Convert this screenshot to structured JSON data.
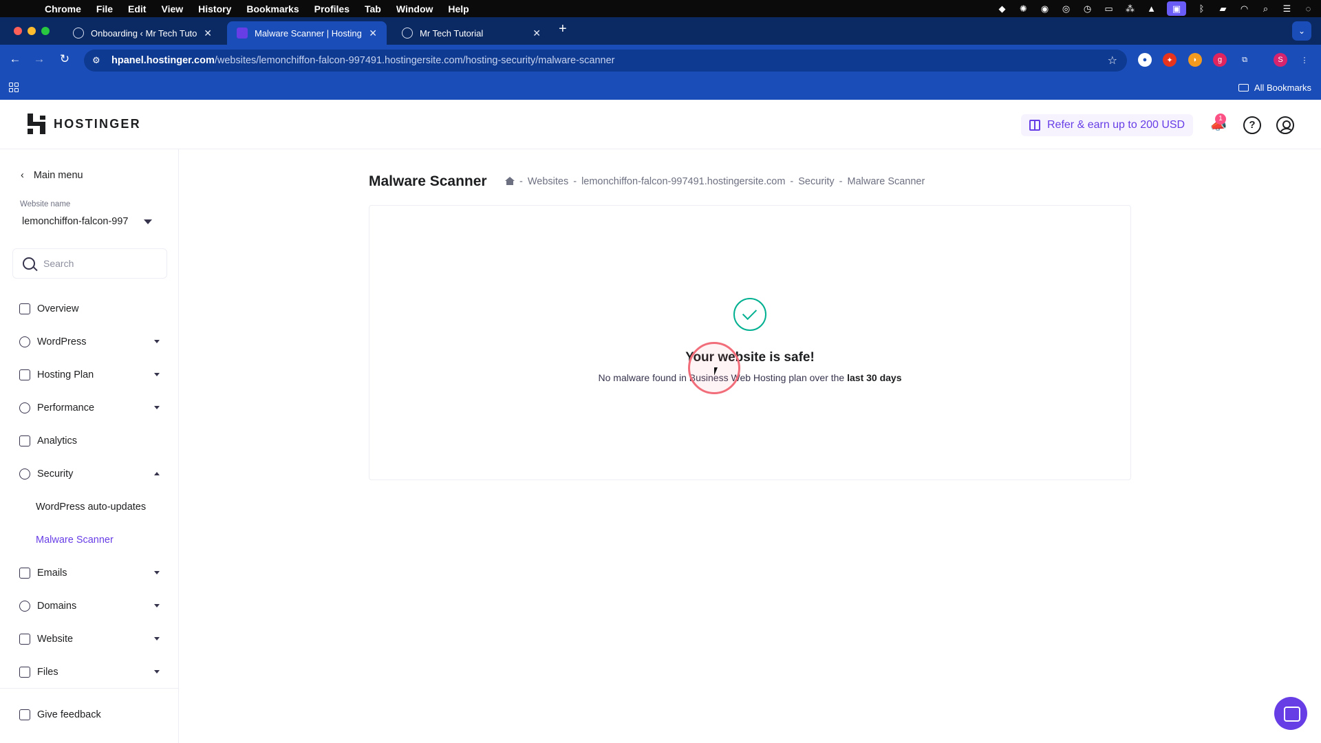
{
  "mac_menubar": {
    "items": [
      "Chrome",
      "File",
      "Edit",
      "View",
      "History",
      "Bookmarks",
      "Profiles",
      "Tab",
      "Window",
      "Help"
    ]
  },
  "tabs": [
    {
      "title": "Onboarding ‹ Mr Tech Tutoria",
      "active": false
    },
    {
      "title": "Malware Scanner | Hostinger",
      "active": true
    },
    {
      "title": "Mr Tech Tutorial",
      "active": false
    }
  ],
  "address_bar": {
    "host": "hpanel.hostinger.com",
    "path": "/websites/lemonchiffon-falcon-997491.hostingersite.com/hosting-security/malware-scanner"
  },
  "bookmarks_bar": {
    "all_bookmarks": "All Bookmarks"
  },
  "header": {
    "logo_text": "HOSTINGER",
    "refer_label": "Refer & earn up to 200 USD",
    "notification_count": "1"
  },
  "sidebar": {
    "main_menu": "Main menu",
    "website_label": "Website name",
    "website_value": "lemonchiffon-falcon-997",
    "search_placeholder": "Search",
    "items": [
      {
        "label": "Overview",
        "icon": "grid-icon",
        "expandable": false
      },
      {
        "label": "WordPress",
        "icon": "wordpress-icon",
        "expandable": true
      },
      {
        "label": "Hosting Plan",
        "icon": "server-icon",
        "expandable": true
      },
      {
        "label": "Performance",
        "icon": "gauge-icon",
        "expandable": true
      },
      {
        "label": "Analytics",
        "icon": "chart-icon",
        "expandable": false
      },
      {
        "label": "Security",
        "icon": "shield-icon",
        "expandable": true,
        "expanded": true
      },
      {
        "label": "Emails",
        "icon": "mail-icon",
        "expandable": true
      },
      {
        "label": "Domains",
        "icon": "globe-icon",
        "expandable": true
      },
      {
        "label": "Website",
        "icon": "browser-icon",
        "expandable": true
      },
      {
        "label": "Files",
        "icon": "folder-icon",
        "expandable": true
      }
    ],
    "security_subitems": [
      "WordPress auto-updates",
      "Malware Scanner"
    ],
    "active_subitem": "Malware Scanner",
    "feedback": "Give feedback"
  },
  "main": {
    "title": "Malware Scanner",
    "breadcrumb": [
      "Websites",
      "lemonchiffon-falcon-997491.hostingersite.com",
      "Security",
      "Malware Scanner"
    ],
    "breadcrumb_separator": "-",
    "status_title": "Your website is safe!",
    "status_desc_prefix": "No malware found in Business Web Hosting plan over the",
    "status_desc_bold": "last 30 days"
  },
  "colors": {
    "brand": "#673de6",
    "success": "#00b090",
    "chrome_toolbar": "#1a4db8",
    "chrome_tabbar": "#0b2a63"
  }
}
